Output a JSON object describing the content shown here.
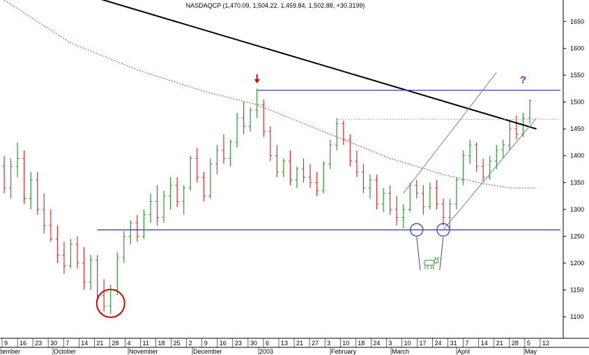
{
  "chart_data": {
    "type": "ohlc",
    "title": "NASDAQCP (1,470.09, 1,504.22, 1,459.84, 1,502.88, +30.3199)",
    "ylim": [
      1060,
      1690
    ],
    "y_ticks": [
      1100,
      1150,
      1200,
      1250,
      1300,
      1350,
      1400,
      1450,
      1500,
      1550,
      1600,
      1650
    ],
    "x_day_labels": [
      "9",
      "16",
      "23",
      "30",
      "7",
      "14",
      "21",
      "28",
      "4",
      "11",
      "18",
      "25",
      "2",
      "9",
      "16",
      "23",
      "30",
      "6",
      "13",
      "21",
      "27",
      "3",
      "10",
      "18",
      "24",
      "3",
      "10",
      "17",
      "24",
      "31",
      "7",
      "14",
      "21",
      "28",
      "5",
      "12"
    ],
    "x_month_labels": [
      "tember",
      "October",
      "November",
      "December",
      "2003",
      "February",
      "March",
      "April",
      "May"
    ],
    "grid": false,
    "colors": {
      "up": "#2e9a2e",
      "down": "#d83030",
      "trendline": "#000000",
      "horizontal_levels": "#4040c0",
      "moving_average": "#c84040",
      "channel": "#808080",
      "annotation_arrow": "#e00000",
      "annotation_question": "#9020a0",
      "circle_low": "#e00000",
      "circle_support": "#4040c0",
      "bull_icon": "#2e9a2e"
    },
    "series": [
      {
        "kind": "ohlc",
        "bars": [
          [
            1380,
            1400,
            1330,
            1340
          ],
          [
            1340,
            1395,
            1320,
            1380
          ],
          [
            1380,
            1425,
            1360,
            1395
          ],
          [
            1395,
            1410,
            1310,
            1320
          ],
          [
            1320,
            1370,
            1300,
            1355
          ],
          [
            1355,
            1370,
            1290,
            1300
          ],
          [
            1300,
            1330,
            1255,
            1270
          ],
          [
            1270,
            1300,
            1240,
            1245
          ],
          [
            1245,
            1270,
            1200,
            1215
          ],
          [
            1215,
            1240,
            1180,
            1195
          ],
          [
            1195,
            1245,
            1190,
            1235
          ],
          [
            1235,
            1250,
            1190,
            1200
          ],
          [
            1200,
            1230,
            1150,
            1165
          ],
          [
            1165,
            1215,
            1150,
            1205
          ],
          [
            1205,
            1215,
            1130,
            1140
          ],
          [
            1140,
            1170,
            1110,
            1120
          ],
          [
            1120,
            1160,
            1105,
            1150
          ],
          [
            1150,
            1220,
            1140,
            1210
          ],
          [
            1210,
            1260,
            1200,
            1250
          ],
          [
            1250,
            1280,
            1235,
            1275
          ],
          [
            1275,
            1290,
            1240,
            1250
          ],
          [
            1250,
            1300,
            1245,
            1290
          ],
          [
            1290,
            1330,
            1275,
            1315
          ],
          [
            1315,
            1345,
            1270,
            1285
          ],
          [
            1285,
            1335,
            1275,
            1325
          ],
          [
            1325,
            1360,
            1300,
            1345
          ],
          [
            1345,
            1360,
            1305,
            1315
          ],
          [
            1315,
            1345,
            1290,
            1340
          ],
          [
            1340,
            1400,
            1335,
            1395
          ],
          [
            1395,
            1415,
            1350,
            1360
          ],
          [
            1360,
            1370,
            1315,
            1325
          ],
          [
            1325,
            1395,
            1320,
            1385
          ],
          [
            1385,
            1420,
            1365,
            1410
          ],
          [
            1410,
            1440,
            1385,
            1395
          ],
          [
            1395,
            1430,
            1380,
            1425
          ],
          [
            1425,
            1480,
            1415,
            1470
          ],
          [
            1470,
            1500,
            1440,
            1455
          ],
          [
            1455,
            1490,
            1445,
            1485
          ],
          [
            1485,
            1525,
            1470,
            1495
          ],
          [
            1495,
            1505,
            1435,
            1445
          ],
          [
            1445,
            1455,
            1390,
            1400
          ],
          [
            1400,
            1420,
            1360,
            1370
          ],
          [
            1370,
            1395,
            1360,
            1390
          ],
          [
            1390,
            1410,
            1345,
            1355
          ],
          [
            1355,
            1380,
            1340,
            1375
          ],
          [
            1375,
            1395,
            1350,
            1360
          ],
          [
            1360,
            1385,
            1340,
            1350
          ],
          [
            1350,
            1370,
            1325,
            1335
          ],
          [
            1335,
            1390,
            1330,
            1385
          ],
          [
            1385,
            1430,
            1375,
            1420
          ],
          [
            1420,
            1470,
            1410,
            1460
          ],
          [
            1460,
            1465,
            1420,
            1430
          ],
          [
            1430,
            1440,
            1380,
            1390
          ],
          [
            1390,
            1410,
            1360,
            1370
          ],
          [
            1370,
            1385,
            1330,
            1340
          ],
          [
            1340,
            1365,
            1320,
            1355
          ],
          [
            1355,
            1365,
            1300,
            1310
          ],
          [
            1310,
            1340,
            1295,
            1330
          ],
          [
            1330,
            1345,
            1290,
            1300
          ],
          [
            1300,
            1325,
            1270,
            1285
          ],
          [
            1285,
            1310,
            1265,
            1300
          ],
          [
            1300,
            1350,
            1295,
            1345
          ],
          [
            1345,
            1355,
            1320,
            1330
          ],
          [
            1330,
            1345,
            1290,
            1305
          ],
          [
            1305,
            1350,
            1300,
            1340
          ],
          [
            1340,
            1355,
            1300,
            1310
          ],
          [
            1310,
            1320,
            1270,
            1285
          ],
          [
            1285,
            1320,
            1265,
            1310
          ],
          [
            1310,
            1360,
            1300,
            1355
          ],
          [
            1355,
            1410,
            1345,
            1400
          ],
          [
            1400,
            1430,
            1385,
            1420
          ],
          [
            1420,
            1425,
            1370,
            1380
          ],
          [
            1380,
            1395,
            1350,
            1360
          ],
          [
            1360,
            1400,
            1355,
            1390
          ],
          [
            1390,
            1420,
            1375,
            1410
          ],
          [
            1410,
            1430,
            1395,
            1420
          ],
          [
            1420,
            1465,
            1410,
            1450
          ],
          [
            1450,
            1475,
            1430,
            1440
          ],
          [
            1440,
            1480,
            1435,
            1470
          ],
          [
            1470,
            1504.22,
            1459.84,
            1502.88
          ]
        ]
      },
      {
        "kind": "moving_average",
        "style": "dotted",
        "points": [
          [
            0,
            1690
          ],
          [
            10,
            1610
          ],
          [
            20,
            1560
          ],
          [
            30,
            1520
          ],
          [
            38,
            1495
          ],
          [
            48,
            1445
          ],
          [
            58,
            1395
          ],
          [
            66,
            1365
          ],
          [
            72,
            1348
          ],
          [
            76,
            1340
          ],
          [
            80,
            1340
          ]
        ]
      },
      {
        "kind": "trendline",
        "points": [
          [
            0,
            1745
          ],
          [
            80,
            1450
          ]
        ]
      },
      {
        "kind": "horizontal_level",
        "y": 1522,
        "from": 38
      },
      {
        "kind": "horizontal_level",
        "y": 1262,
        "from": 14
      },
      {
        "kind": "horizontal_level",
        "style": "dotted",
        "y": 1468,
        "from": 50
      },
      {
        "kind": "channel_line",
        "points": [
          [
            66,
            1262
          ],
          [
            80,
            1470
          ]
        ]
      },
      {
        "kind": "channel_line",
        "points": [
          [
            60,
            1330
          ],
          [
            74,
            1555
          ]
        ]
      }
    ],
    "annotations": [
      {
        "kind": "arrow",
        "at": [
          38,
          1540
        ]
      },
      {
        "kind": "question",
        "text": "?",
        "at": [
          78,
          1535
        ]
      },
      {
        "kind": "circle",
        "at": [
          16,
          1125
        ]
      },
      {
        "kind": "circle",
        "at": [
          62,
          1262
        ]
      },
      {
        "kind": "circle",
        "at": [
          66,
          1262
        ]
      },
      {
        "kind": "bull_icon",
        "at": [
          64,
          1200
        ]
      }
    ]
  }
}
